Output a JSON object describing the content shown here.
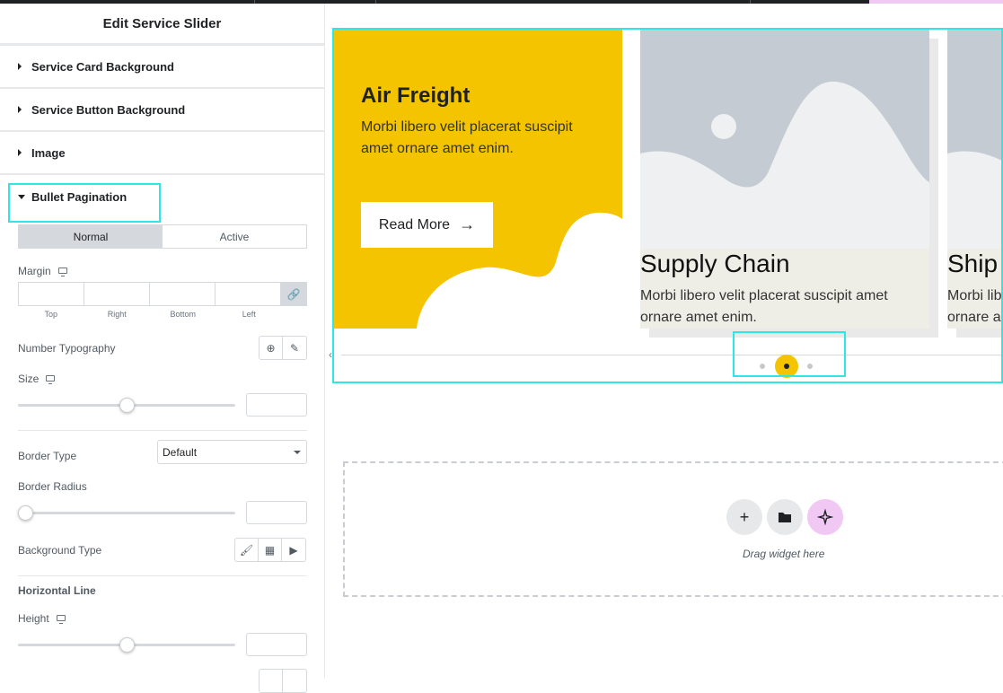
{
  "panel": {
    "title": "Edit Service Slider",
    "sections": [
      {
        "label": "Service Card Background"
      },
      {
        "label": "Service Button Background"
      },
      {
        "label": "Image"
      },
      {
        "label": "Bullet Pagination"
      }
    ],
    "tabs": {
      "normal": "Normal",
      "active": "Active"
    },
    "margin": {
      "label": "Margin",
      "unit": "px",
      "sides": [
        "Top",
        "Right",
        "Bottom",
        "Left"
      ]
    },
    "number_typography": {
      "label": "Number Typography"
    },
    "size": {
      "label": "Size",
      "unit": "px",
      "value": 0.5
    },
    "border_type": {
      "label": "Border Type",
      "value": "Default"
    },
    "border_radius": {
      "label": "Border Radius",
      "unit": "px",
      "value": 0
    },
    "background_type": {
      "label": "Background Type"
    },
    "horizontal_line": {
      "heading": "Horizontal Line",
      "height": {
        "label": "Height",
        "unit": "px",
        "value": 0.5
      }
    }
  },
  "slider": {
    "cards": [
      {
        "title": "Air Freight",
        "text": "Morbi libero velit placerat suscipit amet ornare amet enim.",
        "button": "Read More",
        "button_icon": "arrow-right-icon"
      },
      {
        "title": "Supply Chain",
        "text": "Morbi libero velit placerat suscipit amet ornare amet enim."
      },
      {
        "title": "Ship",
        "text": "Morbi libero velit placerat suscipit amet ornare amet enim."
      }
    ],
    "active_bullet": 2,
    "bullet_count": 3
  },
  "dropzone": {
    "text": "Drag widget here",
    "buttons": [
      "add-icon",
      "folder-icon",
      "ai-sparkle-icon"
    ]
  },
  "colors": {
    "highlight": "#2ee6e6",
    "card_yellow": "#f5c400",
    "ai_button": "#f0c8f3"
  }
}
